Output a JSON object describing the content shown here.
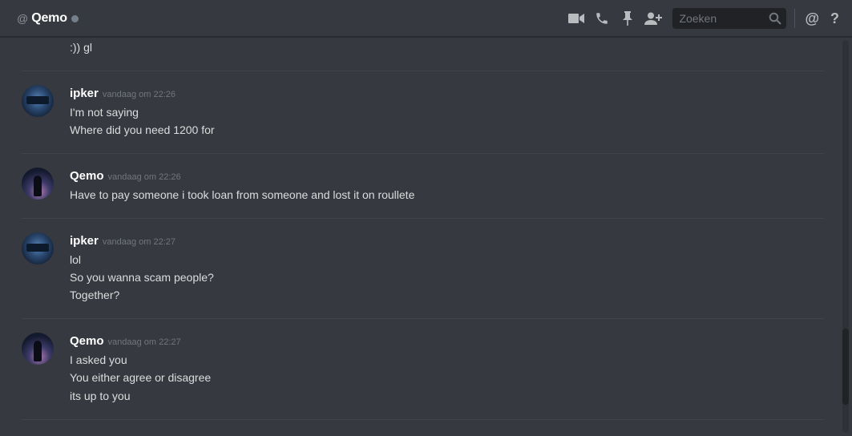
{
  "header": {
    "at_symbol": "@",
    "channel_name": "Qemo"
  },
  "toolbar": {
    "search_placeholder": "Zoeken",
    "icons": [
      "video-call-icon",
      "phone-icon",
      "pin-icon",
      "add-friend-icon",
      "search-icon",
      "mention-icon",
      "help-icon"
    ],
    "mention_glyph": "@",
    "help_glyph": "?"
  },
  "messages": {
    "prev_tail": ":)) gl",
    "groups": [
      {
        "author": "ipker",
        "timestamp": "vandaag om 22:26",
        "lines": [
          "I'm not saying",
          "Where did you need 1200 for"
        ]
      },
      {
        "author": "Qemo",
        "timestamp": "vandaag om 22:26",
        "lines": [
          "Have to pay someone i took loan from someone and lost it on roullete"
        ]
      },
      {
        "author": "ipker",
        "timestamp": "vandaag om 22:27",
        "lines": [
          "lol",
          "So you wanna scam people?",
          "Together?"
        ]
      },
      {
        "author": "Qemo",
        "timestamp": "vandaag om 22:27",
        "lines": [
          "I asked you",
          "You either agree or disagree",
          "its up to you"
        ]
      }
    ]
  },
  "colors": {
    "background": "#36393f",
    "username": "#ffffff",
    "text": "#dcddde",
    "timestamp": "#72767d",
    "offline_status": "#747f8d"
  }
}
